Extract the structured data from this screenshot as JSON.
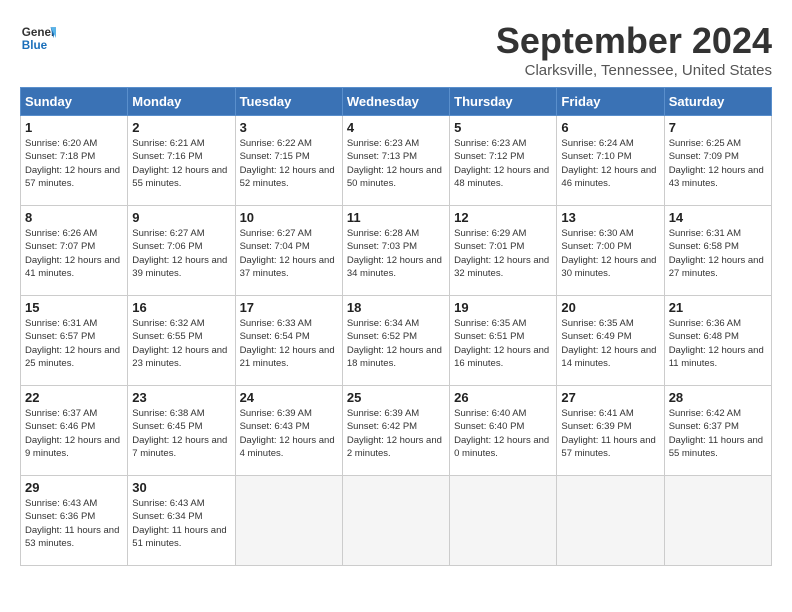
{
  "header": {
    "logo_line1": "General",
    "logo_line2": "Blue",
    "month_title": "September 2024",
    "subtitle": "Clarksville, Tennessee, United States"
  },
  "weekdays": [
    "Sunday",
    "Monday",
    "Tuesday",
    "Wednesday",
    "Thursday",
    "Friday",
    "Saturday"
  ],
  "weeks": [
    [
      {
        "day": "1",
        "rise": "6:20 AM",
        "set": "7:18 PM",
        "daylight": "12 hours and 57 minutes."
      },
      {
        "day": "2",
        "rise": "6:21 AM",
        "set": "7:16 PM",
        "daylight": "12 hours and 55 minutes."
      },
      {
        "day": "3",
        "rise": "6:22 AM",
        "set": "7:15 PM",
        "daylight": "12 hours and 52 minutes."
      },
      {
        "day": "4",
        "rise": "6:23 AM",
        "set": "7:13 PM",
        "daylight": "12 hours and 50 minutes."
      },
      {
        "day": "5",
        "rise": "6:23 AM",
        "set": "7:12 PM",
        "daylight": "12 hours and 48 minutes."
      },
      {
        "day": "6",
        "rise": "6:24 AM",
        "set": "7:10 PM",
        "daylight": "12 hours and 46 minutes."
      },
      {
        "day": "7",
        "rise": "6:25 AM",
        "set": "7:09 PM",
        "daylight": "12 hours and 43 minutes."
      }
    ],
    [
      {
        "day": "8",
        "rise": "6:26 AM",
        "set": "7:07 PM",
        "daylight": "12 hours and 41 minutes."
      },
      {
        "day": "9",
        "rise": "6:27 AM",
        "set": "7:06 PM",
        "daylight": "12 hours and 39 minutes."
      },
      {
        "day": "10",
        "rise": "6:27 AM",
        "set": "7:04 PM",
        "daylight": "12 hours and 37 minutes."
      },
      {
        "day": "11",
        "rise": "6:28 AM",
        "set": "7:03 PM",
        "daylight": "12 hours and 34 minutes."
      },
      {
        "day": "12",
        "rise": "6:29 AM",
        "set": "7:01 PM",
        "daylight": "12 hours and 32 minutes."
      },
      {
        "day": "13",
        "rise": "6:30 AM",
        "set": "7:00 PM",
        "daylight": "12 hours and 30 minutes."
      },
      {
        "day": "14",
        "rise": "6:31 AM",
        "set": "6:58 PM",
        "daylight": "12 hours and 27 minutes."
      }
    ],
    [
      {
        "day": "15",
        "rise": "6:31 AM",
        "set": "6:57 PM",
        "daylight": "12 hours and 25 minutes."
      },
      {
        "day": "16",
        "rise": "6:32 AM",
        "set": "6:55 PM",
        "daylight": "12 hours and 23 minutes."
      },
      {
        "day": "17",
        "rise": "6:33 AM",
        "set": "6:54 PM",
        "daylight": "12 hours and 21 minutes."
      },
      {
        "day": "18",
        "rise": "6:34 AM",
        "set": "6:52 PM",
        "daylight": "12 hours and 18 minutes."
      },
      {
        "day": "19",
        "rise": "6:35 AM",
        "set": "6:51 PM",
        "daylight": "12 hours and 16 minutes."
      },
      {
        "day": "20",
        "rise": "6:35 AM",
        "set": "6:49 PM",
        "daylight": "12 hours and 14 minutes."
      },
      {
        "day": "21",
        "rise": "6:36 AM",
        "set": "6:48 PM",
        "daylight": "12 hours and 11 minutes."
      }
    ],
    [
      {
        "day": "22",
        "rise": "6:37 AM",
        "set": "6:46 PM",
        "daylight": "12 hours and 9 minutes."
      },
      {
        "day": "23",
        "rise": "6:38 AM",
        "set": "6:45 PM",
        "daylight": "12 hours and 7 minutes."
      },
      {
        "day": "24",
        "rise": "6:39 AM",
        "set": "6:43 PM",
        "daylight": "12 hours and 4 minutes."
      },
      {
        "day": "25",
        "rise": "6:39 AM",
        "set": "6:42 PM",
        "daylight": "12 hours and 2 minutes."
      },
      {
        "day": "26",
        "rise": "6:40 AM",
        "set": "6:40 PM",
        "daylight": "12 hours and 0 minutes."
      },
      {
        "day": "27",
        "rise": "6:41 AM",
        "set": "6:39 PM",
        "daylight": "11 hours and 57 minutes."
      },
      {
        "day": "28",
        "rise": "6:42 AM",
        "set": "6:37 PM",
        "daylight": "11 hours and 55 minutes."
      }
    ],
    [
      {
        "day": "29",
        "rise": "6:43 AM",
        "set": "6:36 PM",
        "daylight": "11 hours and 53 minutes."
      },
      {
        "day": "30",
        "rise": "6:43 AM",
        "set": "6:34 PM",
        "daylight": "11 hours and 51 minutes."
      },
      null,
      null,
      null,
      null,
      null
    ]
  ]
}
